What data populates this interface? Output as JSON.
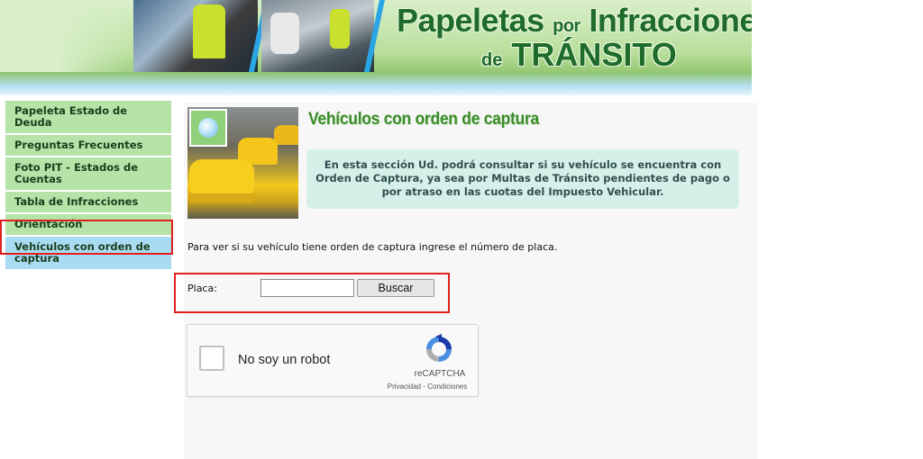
{
  "header": {
    "title_line1_a": "Papeletas",
    "title_line1_b": "por",
    "title_line1_c": "Infracciones",
    "title_line2_a": "de",
    "title_line2_b": "TRÁNSITO"
  },
  "sidebar": {
    "items": [
      {
        "label": "Papeleta Estado de Deuda"
      },
      {
        "label": "Preguntas Frecuentes"
      },
      {
        "label": "Foto PIT - Estados de Cuentas"
      },
      {
        "label": "Tabla de Infracciones"
      },
      {
        "label": "Orientación"
      },
      {
        "label": "Vehículos con orden de captura",
        "active": true
      }
    ]
  },
  "main": {
    "section_title": "Vehículos con orden de captura",
    "info_text": "En esta sección Ud. podrá consultar si su vehículo se encuentra con Orden de Captura, ya sea por Multas de Tránsito pendientes de pago o por atraso en las cuotas del Impuesto Vehicular.",
    "instructions": "Para ver si su vehículo tiene orden de captura ingrese el número de placa.",
    "placa_label": "Placa:",
    "placa_value": "",
    "search_button": "Buscar"
  },
  "captcha": {
    "checkbox_label": "No soy un robot",
    "brand": "reCAPTCHA",
    "privacy_link": "Privacidad",
    "separator": " - ",
    "terms_link": "Condiciones"
  },
  "colors": {
    "menu_bg": "#b5e3a8",
    "menu_active_bg": "#a9dcf3",
    "highlight_border": "#e02020",
    "title_green": "#3a8a2a",
    "info_bg": "#d7efe9"
  },
  "icons": {
    "thumb_icon": "globe-icon",
    "captcha_logo": "recaptcha-logo-icon"
  }
}
